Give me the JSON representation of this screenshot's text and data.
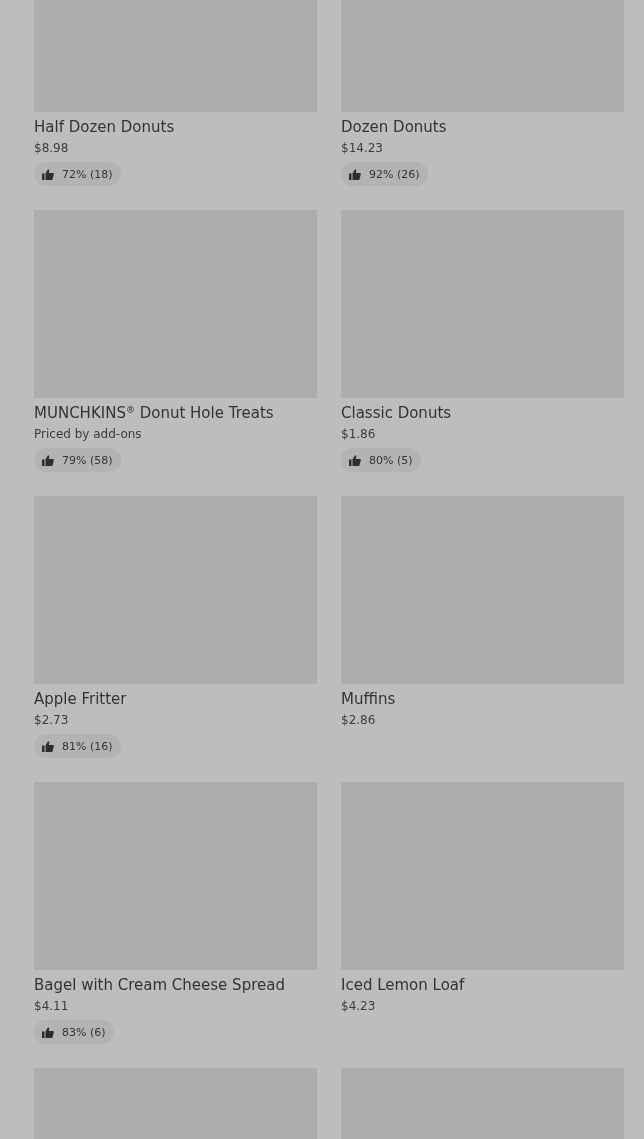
{
  "items": [
    {
      "kind": "product",
      "name": "Half Dozen Donuts",
      "price": "$8.98",
      "rating": "72% (18)"
    },
    {
      "kind": "product",
      "name": "Dozen Donuts",
      "price": "$14.23",
      "rating": "92% (26)"
    },
    {
      "kind": "product",
      "name": "MUNCHKINS$^{®}$ Donut Hole Treats",
      "price": "Priced by add-ons",
      "rating": "79% (58)"
    },
    {
      "kind": "product",
      "name": "Classic Donuts",
      "price": "$1.86",
      "rating": "80% (5)"
    },
    {
      "kind": "product",
      "name": "Apple Fritter",
      "price": "$2.73",
      "rating": "81% (16)"
    },
    {
      "kind": "product",
      "name": "Muffins",
      "price": "$2.86"
    },
    {
      "kind": "product",
      "name": "Bagel with Cream Cheese Spread",
      "price": "$4.11",
      "rating": "83% (6)"
    },
    {
      "kind": "product",
      "name": "Iced Lemon Loaf",
      "price": "$4.23"
    },
    {
      "kind": "image-only"
    },
    {
      "kind": "image-only"
    }
  ]
}
